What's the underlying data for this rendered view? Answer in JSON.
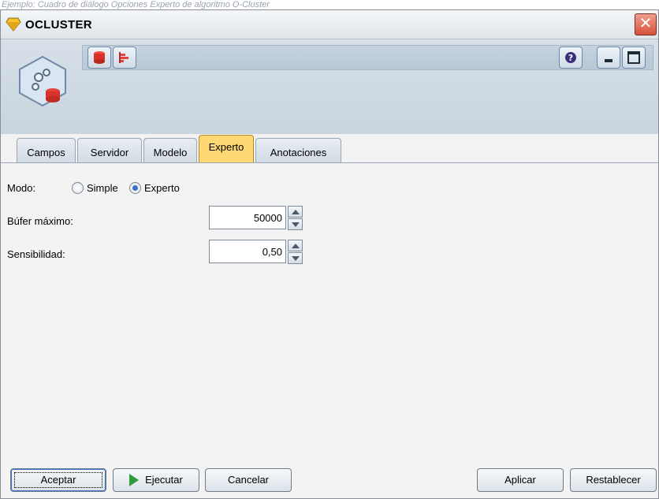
{
  "caption": "Ejemplo: Cuadro de diálogo Opciones Experto de algoritmo O-Cluster",
  "window": {
    "title": "OCLUSTER",
    "close_symbol": "✕"
  },
  "tabs": [
    {
      "label": "Campos"
    },
    {
      "label": "Servidor"
    },
    {
      "label": "Modelo"
    },
    {
      "label": "Experto"
    },
    {
      "label": "Anotaciones"
    }
  ],
  "active_tab": "Experto",
  "form": {
    "mode_label": "Modo:",
    "mode_options": [
      {
        "label": "Simple",
        "checked": false
      },
      {
        "label": "Experto",
        "checked": true
      }
    ],
    "max_buffer_label": "Búfer máximo:",
    "max_buffer_value": "50000",
    "sensitivity_label": "Sensibilidad:",
    "sensitivity_value": "0,50"
  },
  "footer": {
    "ok_label": "Aceptar",
    "run_label": "Ejecutar",
    "cancel_label": "Cancelar",
    "apply_label": "Aplicar",
    "reset_label": "Restablecer"
  },
  "icons": {
    "app": "diamond-node-icon",
    "node": "cluster-node-icon",
    "toolbar": [
      "database-icon",
      "bar-chart-icon"
    ],
    "help": "help-icon",
    "minimize": "minimize-icon",
    "maximize": "maximize-icon"
  }
}
